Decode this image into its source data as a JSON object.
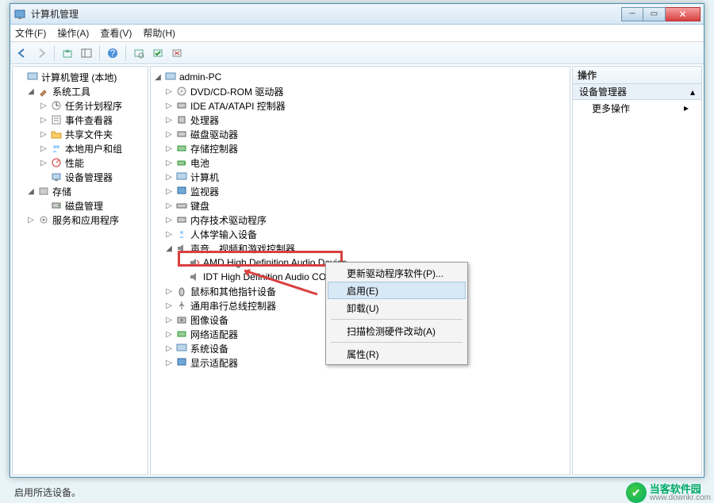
{
  "window": {
    "title": "计算机管理"
  },
  "menu": {
    "file": "文件(F)",
    "action": "操作(A)",
    "view": "查看(V)",
    "help": "帮助(H)"
  },
  "leftTree": {
    "root": "计算机管理 (本地)",
    "sysTools": "系统工具",
    "taskSched": "任务计划程序",
    "eventViewer": "事件查看器",
    "sharedFolders": "共享文件夹",
    "localUsers": "本地用户和组",
    "perf": "性能",
    "devMgr": "设备管理器",
    "storage": "存储",
    "diskMgmt": "磁盘管理",
    "services": "服务和应用程序"
  },
  "midTree": {
    "root": "admin-PC",
    "dvd": "DVD/CD-ROM 驱动器",
    "ide": "IDE ATA/ATAPI 控制器",
    "cpu": "处理器",
    "disk": "磁盘驱动器",
    "storageCtrl": "存储控制器",
    "battery": "电池",
    "computer": "计算机",
    "monitor": "监视器",
    "keyboard": "键盘",
    "memory": "内存技术驱动程序",
    "hid": "人体学输入设备",
    "sound": "声音、视频和游戏控制器",
    "amd": "AMD High Definition Audio Device",
    "idt": "IDT High Definition Audio CODEC",
    "mouse": "鼠标和其他指针设备",
    "usb": "通用串行总线控制器",
    "imaging": "图像设备",
    "network": "网络适配器",
    "system": "系统设备",
    "display": "显示适配器"
  },
  "ctx": {
    "update": "更新驱动程序软件(P)...",
    "enable": "启用(E)",
    "uninstall": "卸载(U)",
    "scan": "扫描检测硬件改动(A)",
    "props": "属性(R)"
  },
  "right": {
    "header": "操作",
    "sec": "设备管理器",
    "more": "更多操作"
  },
  "status": "启用所选设备。",
  "wm": {
    "name": "当客软件园",
    "url": "www.downkr.com"
  }
}
